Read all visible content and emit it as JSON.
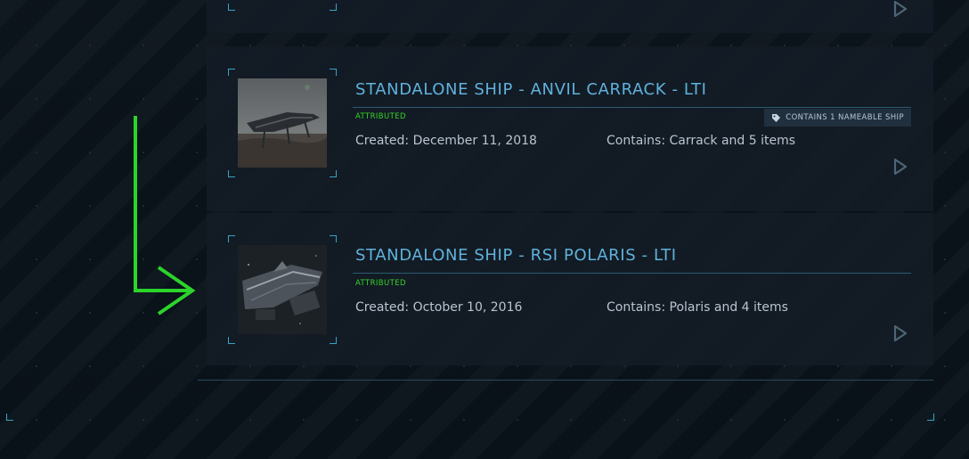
{
  "colors": {
    "accent_blue": "#5fb2dc",
    "attributed_green": "#33d626",
    "arrow_green": "#2bd42b",
    "card_bg": "#131c26"
  },
  "pledges": [
    {
      "title": "STANDALONE SHIP - ANVIL CARRACK - LTI",
      "status": "ATTRIBUTED",
      "badge": {
        "icon": "tag-icon",
        "label": "CONTAINS 1 NAMEABLE SHIP"
      },
      "created": "Created: December 11, 2018",
      "contains": "Contains: Carrack and 5 items"
    },
    {
      "title": "STANDALONE SHIP - RSI POLARIS - LTI",
      "status": "ATTRIBUTED",
      "created": "Created: October 10, 2016",
      "contains": "Contains: Polaris and 4 items"
    }
  ]
}
